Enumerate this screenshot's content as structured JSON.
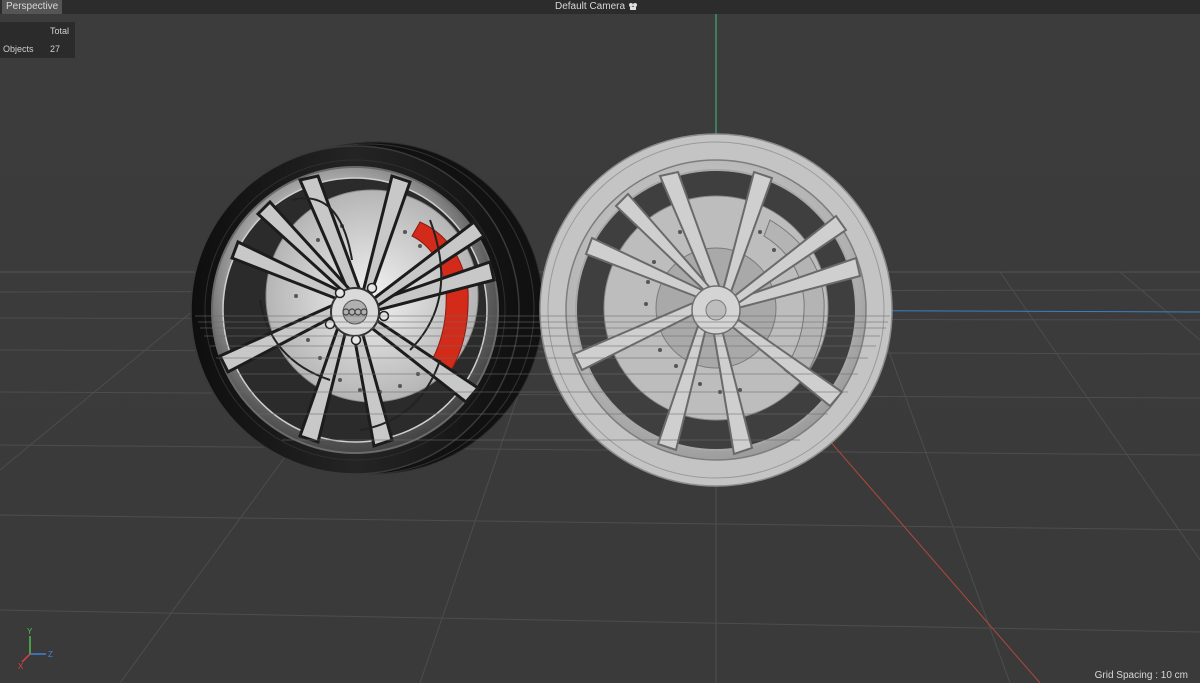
{
  "viewport": {
    "view_name": "Perspective",
    "camera_name": "Default Camera",
    "camera_icon": "camera-icon",
    "grid_spacing": "Grid Spacing : 10 cm"
  },
  "stats": {
    "column_header": "Total",
    "rows": [
      {
        "label": "Objects",
        "value": "27"
      }
    ]
  },
  "axis_gizmo": {
    "y_label": "Y",
    "x_label": "X",
    "z_label": "Z",
    "colors": {
      "x": "#e04040",
      "y": "#50c050",
      "z": "#4080e0"
    }
  },
  "scene": {
    "objects": [
      "textured-wheel",
      "untextured-wheel"
    ],
    "colors": {
      "background": "#3a3a3a",
      "grid_line": "#4a4a4a",
      "caliper": "#d42a1a",
      "tire_dark": "#161616",
      "clay": "#b8b8b8"
    }
  }
}
